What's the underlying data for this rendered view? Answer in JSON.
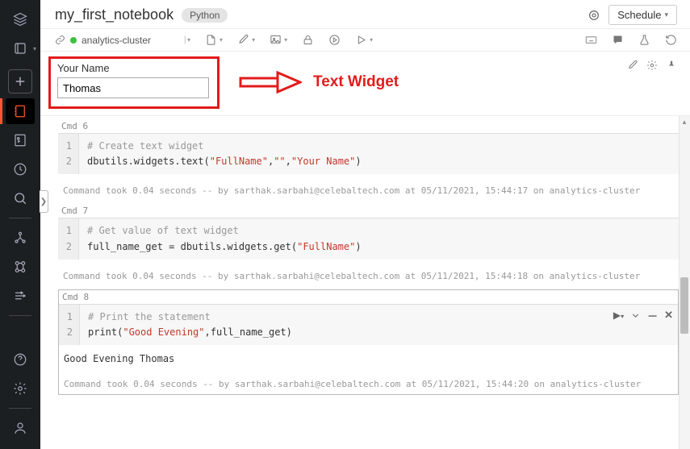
{
  "header": {
    "title": "my_first_notebook",
    "language": "Python",
    "schedule_label": "Schedule"
  },
  "toolbar": {
    "cluster_name": "analytics-cluster"
  },
  "widget": {
    "label": "Your Name",
    "value": "Thomas",
    "annotation": "Text Widget"
  },
  "cells": [
    {
      "cmd": "Cmd 6",
      "code_lines": [
        {
          "n": "1",
          "comment": "# Create text widget"
        },
        {
          "n": "2",
          "prefix": "dbutils.widgets.text(",
          "str1": "\"FullName\"",
          "mid1": ",",
          "str2": "\"\"",
          "mid2": ",",
          "str3": "\"Your Name\"",
          "suffix": ")"
        }
      ],
      "footer": "Command took 0.04 seconds -- by sarthak.sarbahi@celebaltech.com at 05/11/2021, 15:44:17 on analytics-cluster"
    },
    {
      "cmd": "Cmd 7",
      "code_lines": [
        {
          "n": "1",
          "comment": "# Get value of text widget"
        },
        {
          "n": "2",
          "prefix": "full_name_get = dbutils.widgets.get(",
          "str1": "\"FullName\"",
          "suffix": ")"
        }
      ],
      "footer": "Command took 0.04 seconds -- by sarthak.sarbahi@celebaltech.com at 05/11/2021, 15:44:18 on analytics-cluster"
    },
    {
      "cmd": "Cmd 8",
      "code_lines": [
        {
          "n": "1",
          "comment": "# Print the statement"
        },
        {
          "n": "2",
          "prefix": "print(",
          "str1": "\"Good Evening\"",
          "mid1": ",full_name_get)",
          "suffix": ""
        }
      ],
      "stdout": "Good Evening Thomas",
      "footer": "Command took 0.04 seconds -- by sarthak.sarbahi@celebaltech.com at 05/11/2021, 15:44:20 on analytics-cluster",
      "active": true
    }
  ]
}
